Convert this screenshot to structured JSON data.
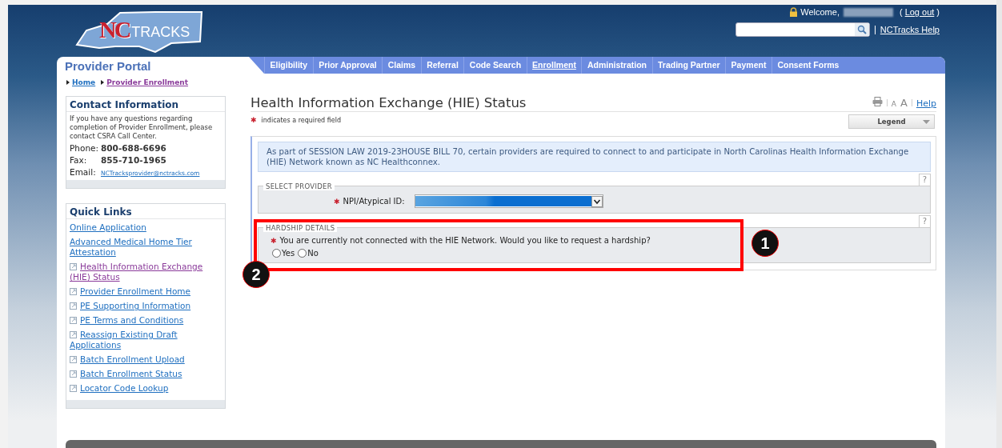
{
  "header": {
    "logo": {
      "mark": "NC",
      "word": "TRACKS"
    },
    "welcome": "Welcome,",
    "paren_open": "(",
    "logout": "Log out",
    "paren_close": ")",
    "help_link": "NCTracks Help"
  },
  "portal_title": "Provider Portal",
  "nav": [
    {
      "label": "Eligibility",
      "selected": false
    },
    {
      "label": "Prior Approval",
      "selected": false
    },
    {
      "label": "Claims",
      "selected": false
    },
    {
      "label": "Referral",
      "selected": false
    },
    {
      "label": "Code Search",
      "selected": false
    },
    {
      "label": "Enrollment",
      "selected": true
    },
    {
      "label": "Administration",
      "selected": false
    },
    {
      "label": "Trading Partner",
      "selected": false
    },
    {
      "label": "Payment",
      "selected": false
    },
    {
      "label": "Consent Forms",
      "selected": false
    }
  ],
  "breadcrumbs": [
    {
      "label": "Home",
      "visited": false
    },
    {
      "label": "Provider Enrollment",
      "visited": true
    }
  ],
  "contact": {
    "title": "Contact Information",
    "intro": "If you have any questions regarding completion of Provider Enrollment, please contact CSRA Call Center.",
    "lines": [
      {
        "label": "Phone:",
        "value": "800-688-6696",
        "kind": "number"
      },
      {
        "label": "Fax:",
        "value": "855-710-1965",
        "kind": "number"
      },
      {
        "label": "Email:",
        "value": "NCTracksprovider@nctracks.com",
        "kind": "email"
      }
    ]
  },
  "quick_links": {
    "title": "Quick Links",
    "items": [
      {
        "label": "Online Application",
        "external": false,
        "visited": false
      },
      {
        "label": "Advanced Medical Home Tier Attestation",
        "external": false,
        "visited": false
      },
      {
        "label": "Health Information Exchange (HIE) Status",
        "external": true,
        "visited": true
      },
      {
        "label": "Provider Enrollment Home",
        "external": true,
        "visited": false
      },
      {
        "label": "PE Supporting Information",
        "external": true,
        "visited": false
      },
      {
        "label": "PE Terms and Conditions",
        "external": true,
        "visited": false
      },
      {
        "label": "Reassign Existing Draft Applications",
        "external": true,
        "visited": false
      },
      {
        "label": "Batch Enrollment Upload",
        "external": true,
        "visited": false
      },
      {
        "label": "Batch Enrollment Status",
        "external": true,
        "visited": false
      },
      {
        "label": "Locator Code Lookup",
        "external": true,
        "visited": false
      }
    ]
  },
  "page": {
    "title": "Health Information Exchange (HIE) Status",
    "text_size": [
      "A",
      "A"
    ],
    "help": "Help",
    "required_note": {
      "mark": "✱",
      "text": "indicates a required field"
    },
    "legend": "Legend"
  },
  "form": {
    "info": "As part of SESSION LAW 2019-23HOUSE BILL 70, certain providers are required to connect to and participate in North Carolinas Health Information Exchange (HIE) Network known as NC Healthconnex.",
    "sections": [
      {
        "kind": "select",
        "help": "?",
        "legend": "SELECT PROVIDER",
        "mark": "✱",
        "label": "NPI/Atypical ID:"
      },
      {
        "kind": "radio",
        "help": "?",
        "legend": "HARDSHIP DETAILS",
        "mark": "✱",
        "question": "You are currently not connected with the HIE Network. Would you like to request a hardship?",
        "options": [
          {
            "label": "Yes",
            "checked": false
          },
          {
            "label": "No",
            "checked": false
          }
        ]
      }
    ]
  },
  "annotations": [
    {
      "label": "1"
    },
    {
      "label": "2"
    }
  ]
}
